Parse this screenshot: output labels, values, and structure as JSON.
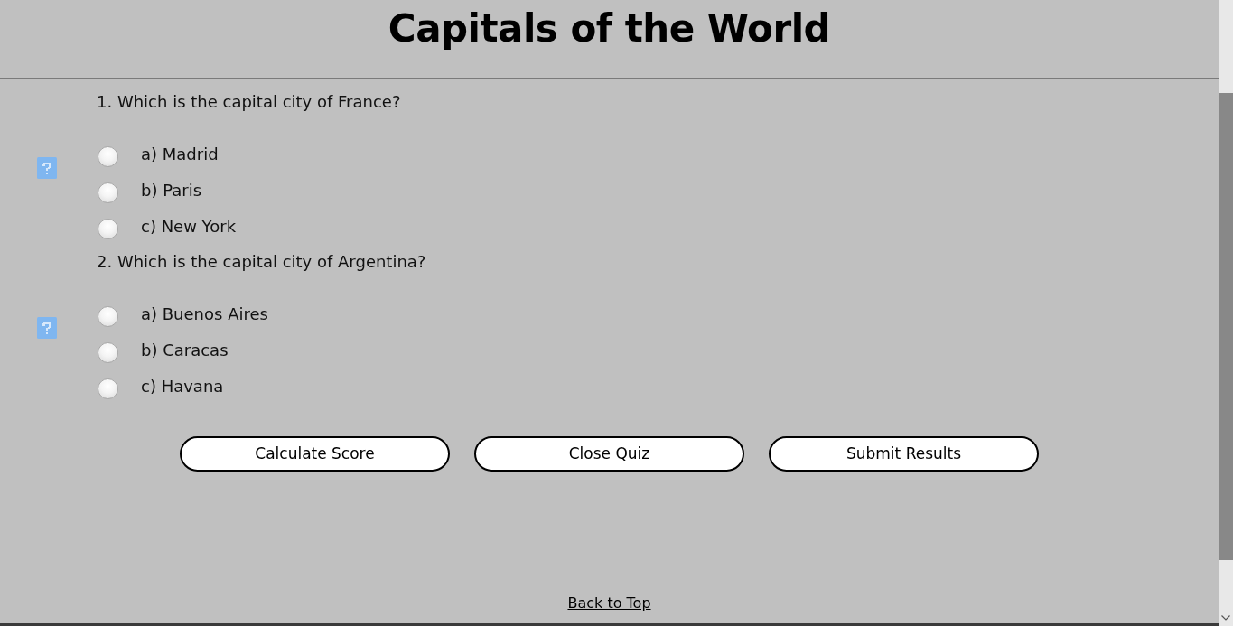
{
  "title": "Capitals of the World",
  "questions": [
    {
      "text": "1. Which is the capital city of France?",
      "options": [
        {
          "label": "a) Madrid",
          "selected": false
        },
        {
          "label": "b) Paris",
          "selected": false
        },
        {
          "label": "c) New York",
          "selected": false
        }
      ]
    },
    {
      "text": "2. Which is the capital city of Argentina?",
      "options": [
        {
          "label": "a) Buenos Aires",
          "selected": false
        },
        {
          "label": "b) Caracas",
          "selected": false
        },
        {
          "label": "c) Havana",
          "selected": false
        }
      ]
    }
  ],
  "buttons": [
    "Calculate Score",
    "Close Quiz",
    "Submit Results"
  ],
  "footer_link": "Back to Top"
}
